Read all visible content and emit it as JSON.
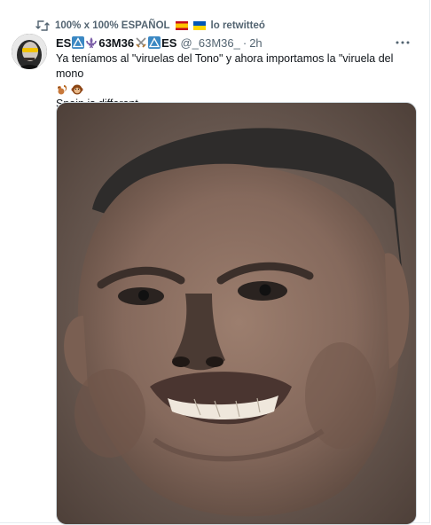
{
  "retweet": {
    "account": "100% x 100% ESPAÑOL",
    "suffix": "lo retwitteó"
  },
  "tweet": {
    "name_prefix": "ES",
    "name_mid": "63M36",
    "name_suffix": "ES",
    "handle": "@_63M36_",
    "separator": "·",
    "time": "2h",
    "text_line1": "Ya teníamos al \"viruelas del Tono\" y ahora importamos la \"viruela del mono",
    "text_line2": "Spain is different...",
    "icons": [
      "retweet-icon",
      "spain-flag-icon",
      "ukraine-flag-icon",
      "warning-sign-icon",
      "fleur-de-lis-icon",
      "crossed-swords-icon",
      "squirrel-icon",
      "monkey-face-icon",
      "more-icon"
    ]
  },
  "colors": {
    "secondary_text": "#536471",
    "primary_text": "#0f1419",
    "border": "#cfd9de",
    "warning_blue": "#3b88c3"
  }
}
